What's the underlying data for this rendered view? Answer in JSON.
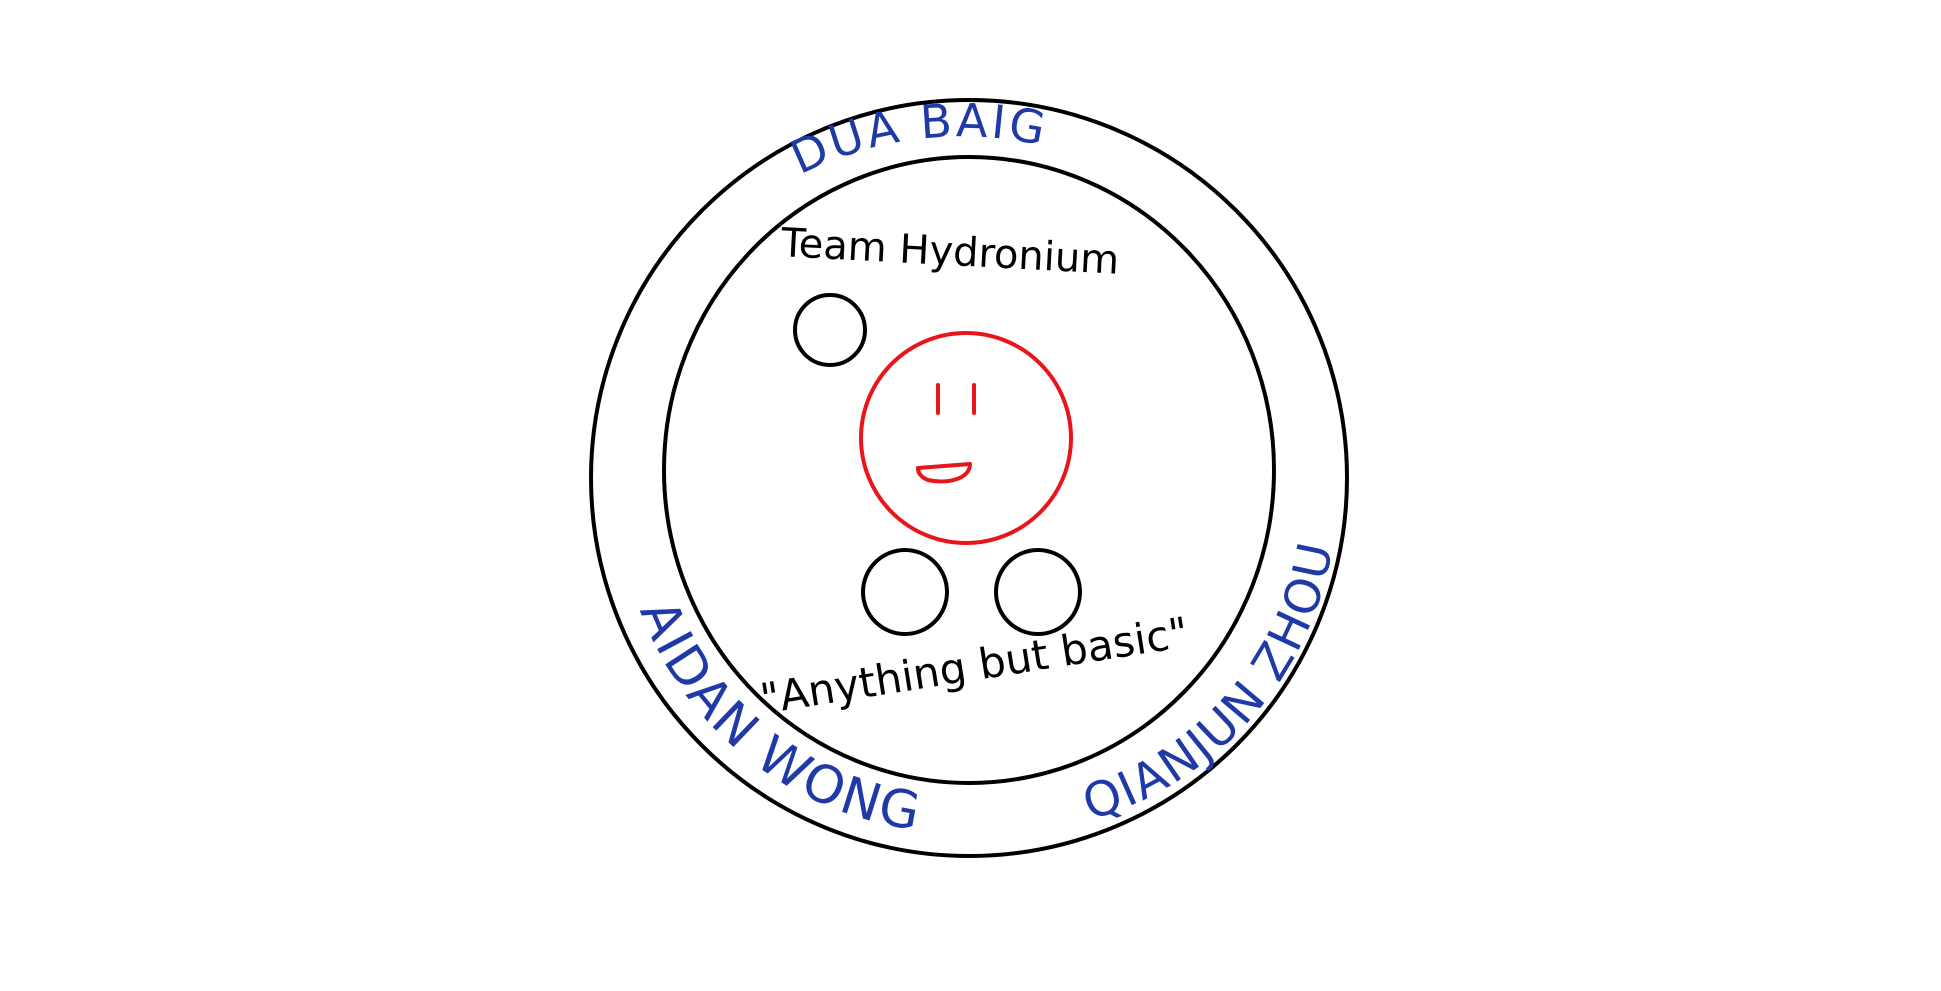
{
  "logo": {
    "top_name": "DUA BAIG",
    "left_name": "AIDAN WONG",
    "right_name": "QIANJUN ZHOU",
    "team_name": "Team Hydronium",
    "motto": "\"Anything but basic\"",
    "colors": {
      "background": "#ffffff",
      "outline": "#000000",
      "names": "#1f3aa6",
      "face": "#e8161b"
    }
  }
}
